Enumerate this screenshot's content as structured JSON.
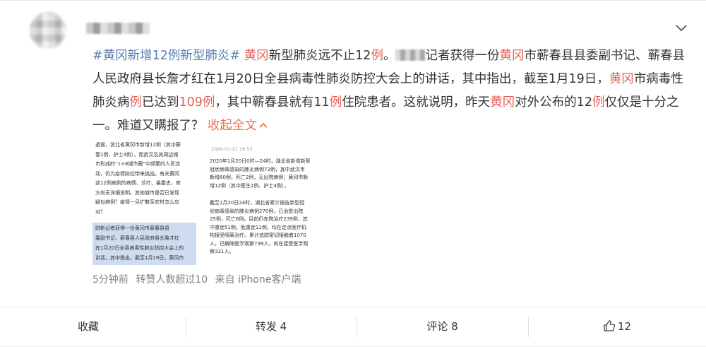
{
  "post": {
    "segments": [
      {
        "t": "#黄冈新增12例新型肺炎#",
        "c": "blue"
      },
      {
        "t": " ",
        "c": ""
      },
      {
        "t": "黄冈",
        "c": "red"
      },
      {
        "t": "新型肺炎远不止12",
        "c": ""
      },
      {
        "t": "例",
        "c": "red"
      },
      {
        "t": "。",
        "c": ""
      },
      {
        "t": "",
        "c": "mask"
      },
      {
        "t": "记者获得一份",
        "c": ""
      },
      {
        "t": "黄冈",
        "c": "red"
      },
      {
        "t": "市蕲春县县委副书记、蕲春县人民政府县长詹才红在1月20日全县病毒性肺炎防控大会上的讲话，其中指出，截至1月19日，",
        "c": ""
      },
      {
        "t": "黄冈",
        "c": "red"
      },
      {
        "t": "市病毒性肺炎病",
        "c": ""
      },
      {
        "t": "例",
        "c": "red"
      },
      {
        "t": "已达到",
        "c": ""
      },
      {
        "t": "109",
        "c": "red"
      },
      {
        "t": "例",
        "c": "red"
      },
      {
        "t": "，其中蕲春县就有11",
        "c": ""
      },
      {
        "t": "例",
        "c": "red"
      },
      {
        "t": "住院患者。这就说明，昨天",
        "c": ""
      },
      {
        "t": "黄冈",
        "c": "red"
      },
      {
        "t": "对外公布的12",
        "c": ""
      },
      {
        "t": "例",
        "c": "red"
      },
      {
        "t": "仅仅是十分之一。难道又瞒报了？ ",
        "c": ""
      }
    ],
    "collapse_label": "收起全文",
    "collapse_icon": "chevron-up-icon"
  },
  "images": {
    "left_lines": [
      "透视，浙北省黄冈市新增12例（其中蕲",
      "春1例、护士4例），而武汉及其周边城",
      "市形成的“1+8城市圈”中频繁的人员流",
      "动，仍为疫情防控带来挑战。有关黄冈",
      "这12例病例的病情、诊疗、暴露史，官",
      "方尚无详细说明。其他城市是否已发现",
      "疑似病例？疫情一旦扩散至农村怎么应",
      "对？"
    ],
    "left_highlight_lines": [
      "财新记者获得一份黄冈市蕲春县县",
      "委副书记、蕲春县人民政府县长詹才红",
      "在1月20日全县病毒性肺炎防控大会上的",
      "讲话，其中指出，截至1月19日，黄冈市"
    ],
    "right_date": "2020-01-21 19:53",
    "right_lines_1": [
      "2020年1月20日0时—24时，湖北省新增新型",
      "冠状病毒感染的肺炎病例72例，其中武汉市",
      "新增60例，死亡2例，无出院病例；黄冈市新",
      "增12例（其中医生1例、护士4例）。"
    ],
    "right_lines_2": [
      "截至1月20日24时，湖北省累计报告新型冠",
      "状病毒感染的肺炎病例270例，已治愈出院",
      "25例，死亡6例。目前仍在院治疗239例，其",
      "中重症51例，危重症12例，均在定点医疗机",
      "构接受隔离治疗。累计追踪密切接触者1070",
      "人，已解除医学观察739人，尚在接受医学观",
      "察331人。"
    ]
  },
  "meta": {
    "time": "5分钟前",
    "reposts": "转赞人数超过10",
    "source": "来自 iPhone客户端"
  },
  "footer": {
    "favorite": "收藏",
    "repost": "转发 4",
    "comment": "评论 8",
    "like": "12"
  },
  "colors": {
    "accent": "#eb7350",
    "topic": "#5d7fb0",
    "keyword": "#e65f57"
  }
}
